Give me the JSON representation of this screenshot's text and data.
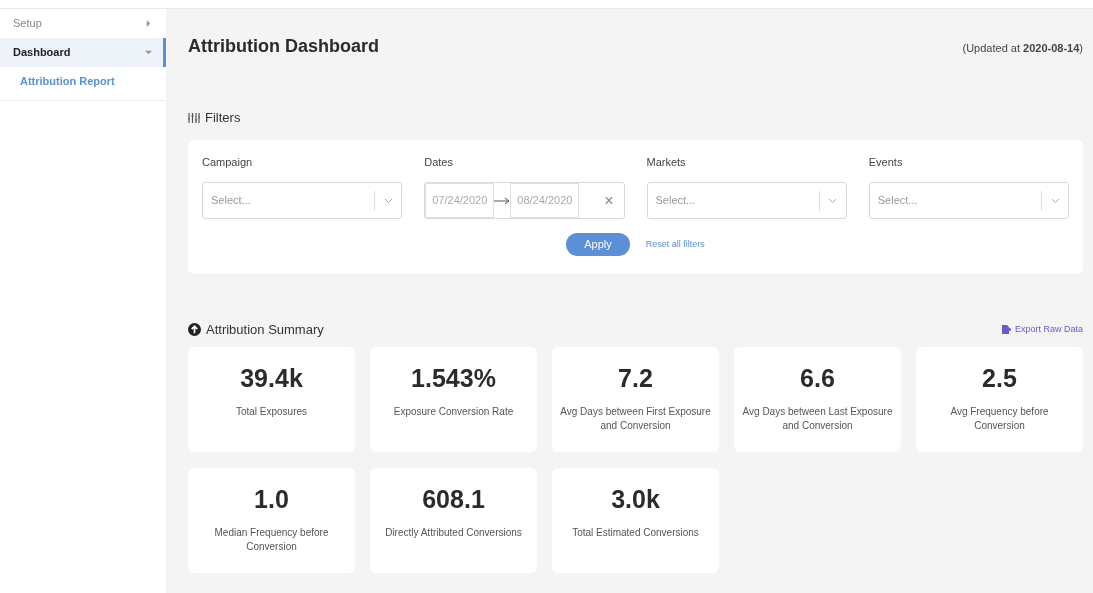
{
  "sidebar": {
    "items": [
      {
        "label": "Setup",
        "selected": false,
        "expanded": false
      },
      {
        "label": "Dashboard",
        "selected": true,
        "expanded": true,
        "children": [
          {
            "label": "Attribution Report",
            "selected": true
          }
        ]
      }
    ]
  },
  "header": {
    "title": "Attribution Dashboard",
    "updated": "(Updated at **2020-08-14**)"
  },
  "filters": {
    "title": "Filters",
    "fields": [
      {
        "kind": "select",
        "label": "Campaign",
        "placeholder": "Select..."
      },
      {
        "kind": "daterange",
        "label": "Dates",
        "start": "07/24/2020",
        "end": "08/24/2020",
        "clear": "×"
      },
      {
        "kind": "select",
        "label": "Markets",
        "placeholder": "Select..."
      },
      {
        "kind": "select",
        "label": "Events",
        "placeholder": "Select..."
      }
    ],
    "apply": "Apply",
    "reset": "Reset all filters"
  },
  "summary": {
    "title": "Attribution Summary",
    "export": "Export Raw Data",
    "stats": [
      {
        "value": "39.4k",
        "label": "Total Exposures"
      },
      {
        "value": "1.543%",
        "label": "Exposure Conversion Rate"
      },
      {
        "value": "7.2",
        "label": "Avg Days between First Exposure and Conversion"
      },
      {
        "value": "6.6",
        "label": "Avg Days between Last Exposure and Conversion"
      },
      {
        "value": "2.5",
        "label": "Avg Frequency before Conversion"
      },
      {
        "value": "1.0",
        "label": "Median Frequency before Conversion"
      },
      {
        "value": "608.1",
        "label": "Directly Attributed Conversions"
      },
      {
        "value": "3.0k",
        "label": "Total Estimated Conversions"
      }
    ]
  }
}
